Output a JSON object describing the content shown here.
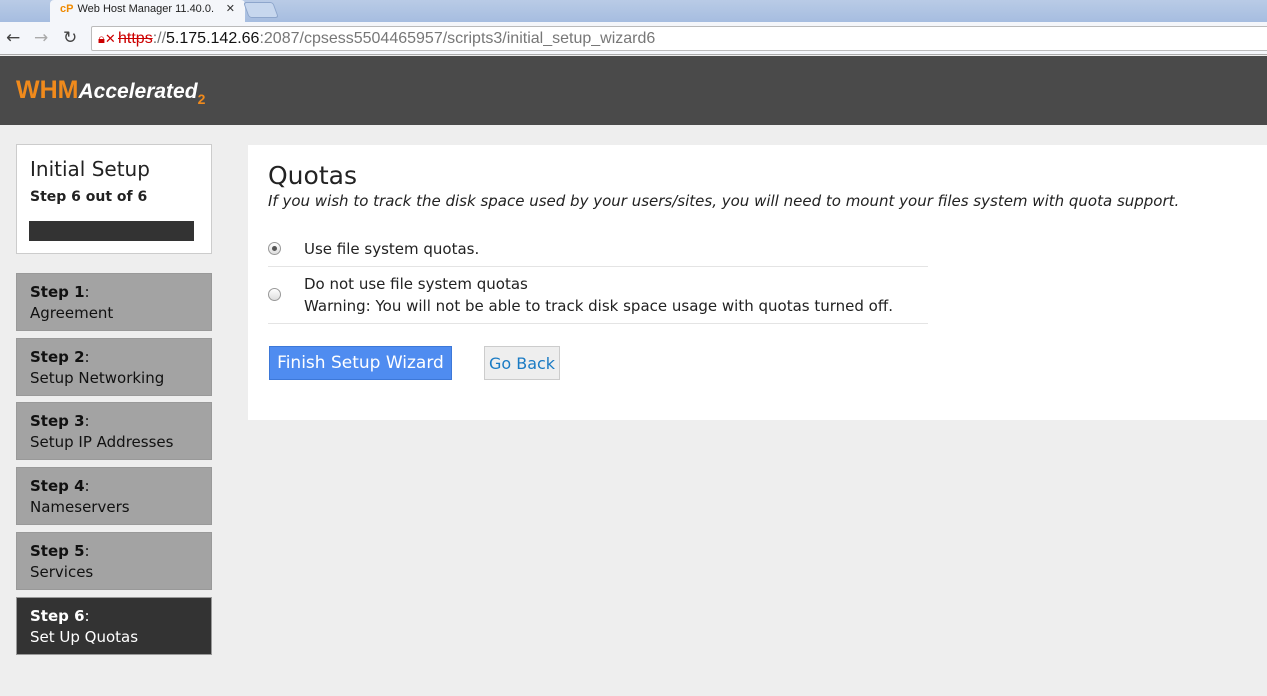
{
  "browser": {
    "tab_title": "Web Host Manager 11.40.0.",
    "tab_icon": "cP",
    "url_scheme": "https",
    "url_host": "5.175.142.66",
    "url_rest": ":2087/cpsess5504465957/scripts3/initial_setup_wizard6"
  },
  "header": {
    "logo_main": "WHM",
    "logo_sub": "Accelerated",
    "logo_ver": "2"
  },
  "sidebar": {
    "title": "Initial Setup",
    "progress_text": "Step 6 out of 6",
    "progress": 1.0,
    "steps": [
      {
        "num": "Step 1",
        "label": "Agreement"
      },
      {
        "num": "Step 2",
        "label": "Setup Networking"
      },
      {
        "num": "Step 3",
        "label": "Setup IP Addresses"
      },
      {
        "num": "Step 4",
        "label": "Nameservers"
      },
      {
        "num": "Step 5",
        "label": "Services"
      },
      {
        "num": "Step 6",
        "label": "Set Up Quotas"
      }
    ]
  },
  "main": {
    "title": "Quotas",
    "description": "If you wish to track the disk space used by your users/sites, you will need to mount your files system with quota support.",
    "options": [
      {
        "label": "Use file system quotas.",
        "selected": true
      },
      {
        "label": "Do not use file system quotas",
        "warning": "Warning: You will not be able to track disk space usage with quotas turned off.",
        "selected": false
      }
    ],
    "finish_label": "Finish Setup Wizard",
    "back_label": "Go Back"
  }
}
